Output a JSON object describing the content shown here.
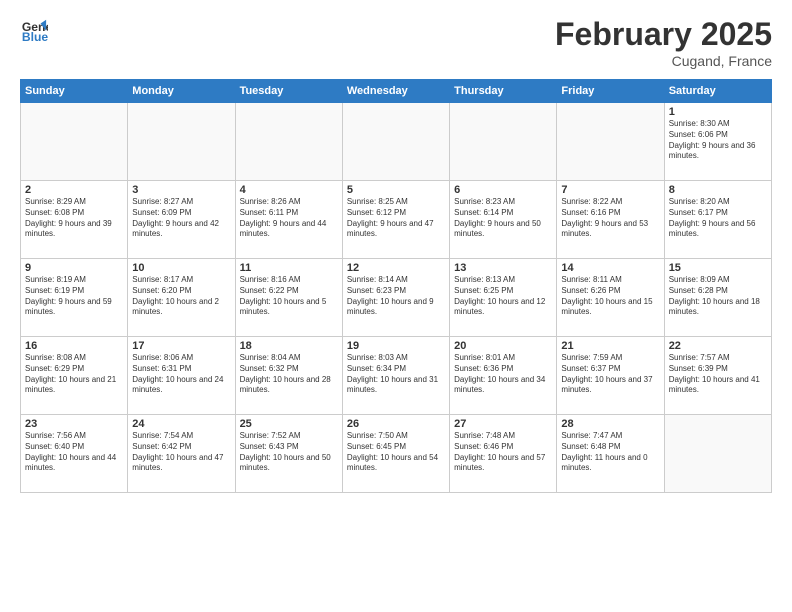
{
  "header": {
    "logo_line1": "General",
    "logo_line2": "Blue",
    "title": "February 2025",
    "subtitle": "Cugand, France"
  },
  "days_of_week": [
    "Sunday",
    "Monday",
    "Tuesday",
    "Wednesday",
    "Thursday",
    "Friday",
    "Saturday"
  ],
  "weeks": [
    [
      {
        "day": "",
        "info": ""
      },
      {
        "day": "",
        "info": ""
      },
      {
        "day": "",
        "info": ""
      },
      {
        "day": "",
        "info": ""
      },
      {
        "day": "",
        "info": ""
      },
      {
        "day": "",
        "info": ""
      },
      {
        "day": "1",
        "info": "Sunrise: 8:30 AM\nSunset: 6:06 PM\nDaylight: 9 hours and 36 minutes."
      }
    ],
    [
      {
        "day": "2",
        "info": "Sunrise: 8:29 AM\nSunset: 6:08 PM\nDaylight: 9 hours and 39 minutes."
      },
      {
        "day": "3",
        "info": "Sunrise: 8:27 AM\nSunset: 6:09 PM\nDaylight: 9 hours and 42 minutes."
      },
      {
        "day": "4",
        "info": "Sunrise: 8:26 AM\nSunset: 6:11 PM\nDaylight: 9 hours and 44 minutes."
      },
      {
        "day": "5",
        "info": "Sunrise: 8:25 AM\nSunset: 6:12 PM\nDaylight: 9 hours and 47 minutes."
      },
      {
        "day": "6",
        "info": "Sunrise: 8:23 AM\nSunset: 6:14 PM\nDaylight: 9 hours and 50 minutes."
      },
      {
        "day": "7",
        "info": "Sunrise: 8:22 AM\nSunset: 6:16 PM\nDaylight: 9 hours and 53 minutes."
      },
      {
        "day": "8",
        "info": "Sunrise: 8:20 AM\nSunset: 6:17 PM\nDaylight: 9 hours and 56 minutes."
      }
    ],
    [
      {
        "day": "9",
        "info": "Sunrise: 8:19 AM\nSunset: 6:19 PM\nDaylight: 9 hours and 59 minutes."
      },
      {
        "day": "10",
        "info": "Sunrise: 8:17 AM\nSunset: 6:20 PM\nDaylight: 10 hours and 2 minutes."
      },
      {
        "day": "11",
        "info": "Sunrise: 8:16 AM\nSunset: 6:22 PM\nDaylight: 10 hours and 5 minutes."
      },
      {
        "day": "12",
        "info": "Sunrise: 8:14 AM\nSunset: 6:23 PM\nDaylight: 10 hours and 9 minutes."
      },
      {
        "day": "13",
        "info": "Sunrise: 8:13 AM\nSunset: 6:25 PM\nDaylight: 10 hours and 12 minutes."
      },
      {
        "day": "14",
        "info": "Sunrise: 8:11 AM\nSunset: 6:26 PM\nDaylight: 10 hours and 15 minutes."
      },
      {
        "day": "15",
        "info": "Sunrise: 8:09 AM\nSunset: 6:28 PM\nDaylight: 10 hours and 18 minutes."
      }
    ],
    [
      {
        "day": "16",
        "info": "Sunrise: 8:08 AM\nSunset: 6:29 PM\nDaylight: 10 hours and 21 minutes."
      },
      {
        "day": "17",
        "info": "Sunrise: 8:06 AM\nSunset: 6:31 PM\nDaylight: 10 hours and 24 minutes."
      },
      {
        "day": "18",
        "info": "Sunrise: 8:04 AM\nSunset: 6:32 PM\nDaylight: 10 hours and 28 minutes."
      },
      {
        "day": "19",
        "info": "Sunrise: 8:03 AM\nSunset: 6:34 PM\nDaylight: 10 hours and 31 minutes."
      },
      {
        "day": "20",
        "info": "Sunrise: 8:01 AM\nSunset: 6:36 PM\nDaylight: 10 hours and 34 minutes."
      },
      {
        "day": "21",
        "info": "Sunrise: 7:59 AM\nSunset: 6:37 PM\nDaylight: 10 hours and 37 minutes."
      },
      {
        "day": "22",
        "info": "Sunrise: 7:57 AM\nSunset: 6:39 PM\nDaylight: 10 hours and 41 minutes."
      }
    ],
    [
      {
        "day": "23",
        "info": "Sunrise: 7:56 AM\nSunset: 6:40 PM\nDaylight: 10 hours and 44 minutes."
      },
      {
        "day": "24",
        "info": "Sunrise: 7:54 AM\nSunset: 6:42 PM\nDaylight: 10 hours and 47 minutes."
      },
      {
        "day": "25",
        "info": "Sunrise: 7:52 AM\nSunset: 6:43 PM\nDaylight: 10 hours and 50 minutes."
      },
      {
        "day": "26",
        "info": "Sunrise: 7:50 AM\nSunset: 6:45 PM\nDaylight: 10 hours and 54 minutes."
      },
      {
        "day": "27",
        "info": "Sunrise: 7:48 AM\nSunset: 6:46 PM\nDaylight: 10 hours and 57 minutes."
      },
      {
        "day": "28",
        "info": "Sunrise: 7:47 AM\nSunset: 6:48 PM\nDaylight: 11 hours and 0 minutes."
      },
      {
        "day": "",
        "info": ""
      }
    ]
  ]
}
